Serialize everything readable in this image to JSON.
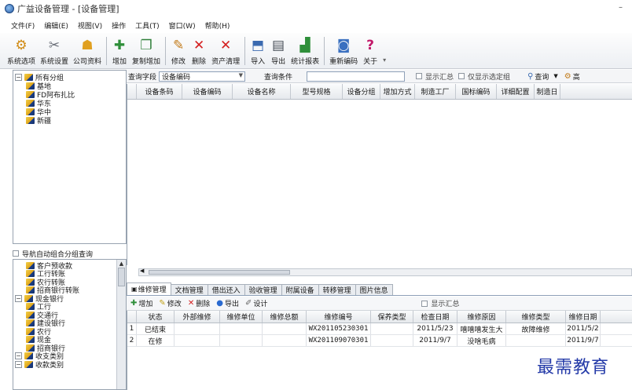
{
  "window": {
    "title": "广益设备管理 - [设备管理]",
    "minimize": "–"
  },
  "menu": [
    "文件(F)",
    "编辑(E)",
    "视图(V)",
    "操作",
    "工具(T)",
    "窗口(W)",
    "帮助(H)"
  ],
  "toolbar": [
    {
      "label": "系统选项",
      "icon": "wrench-icon",
      "glyph": "⚙",
      "color": "#d08a12"
    },
    {
      "label": "系统设置",
      "icon": "tools-icon",
      "glyph": "✂",
      "color": "#6a6f78"
    },
    {
      "label": "公司资料",
      "icon": "company-icon",
      "glyph": "☗",
      "color": "#e0a020"
    },
    {
      "label": "增加",
      "icon": "add-icon",
      "glyph": "✚",
      "color": "#2f8f3a"
    },
    {
      "label": "复制增加",
      "icon": "copy-add-icon",
      "glyph": "❐",
      "color": "#2f7f3a"
    },
    {
      "label": "修改",
      "icon": "edit-icon",
      "glyph": "✎",
      "color": "#c27b1a"
    },
    {
      "label": "删除",
      "icon": "delete-icon",
      "glyph": "✕",
      "color": "#d42020"
    },
    {
      "label": "资产清理",
      "icon": "clear-icon",
      "glyph": "✕",
      "color": "#d42020"
    },
    {
      "label": "导入",
      "icon": "import-icon",
      "glyph": "⬒",
      "color": "#3a6ab0"
    },
    {
      "label": "导出",
      "icon": "export-icon",
      "glyph": "▤",
      "color": "#444b55"
    },
    {
      "label": "统计报表",
      "icon": "report-icon",
      "glyph": "▟",
      "color": "#2f8f3a"
    },
    {
      "label": "重新编码",
      "icon": "recode-icon",
      "glyph": "◙",
      "color": "#3a70c0"
    },
    {
      "label": "关于",
      "icon": "help-icon",
      "glyph": "?",
      "color": "#c21a6a"
    }
  ],
  "tree_top": [
    {
      "label": "所有分组",
      "level": 0
    },
    {
      "label": "基地",
      "level": 1
    },
    {
      "label": "FD阿布扎比",
      "level": 1
    },
    {
      "label": "华东",
      "level": 1
    },
    {
      "label": "华中",
      "level": 1
    },
    {
      "label": "新疆",
      "level": 1
    }
  ],
  "nav_check": "导航自动组合分组查询",
  "tree_bottom": [
    {
      "label": "客户预收款",
      "level": 1
    },
    {
      "label": "工行转账",
      "level": 1
    },
    {
      "label": "农行转账",
      "level": 1
    },
    {
      "label": "招商银行转账",
      "level": 1
    },
    {
      "label": "现金银行",
      "level": 0
    },
    {
      "label": "工行",
      "level": 1
    },
    {
      "label": "交通行",
      "level": 1
    },
    {
      "label": "建设银行",
      "level": 1
    },
    {
      "label": "农行",
      "level": 1
    },
    {
      "label": "现金",
      "level": 1
    },
    {
      "label": "招商银行",
      "level": 1
    },
    {
      "label": "收支类别",
      "level": 0
    },
    {
      "label": "收款类别",
      "level": 0
    }
  ],
  "query": {
    "field_label": "查询字段",
    "field_value": "设备编码",
    "cond_label": "查询条件",
    "show_summary": "显示汇总",
    "only_selected": "仅显示选定组",
    "query_btn": "查询",
    "more_btn": "高"
  },
  "main_columns": [
    "设备条码",
    "设备编码",
    "设备名称",
    "型号规格",
    "设备分组",
    "增加方式",
    "制造工厂",
    "国标编码",
    "详细配置",
    "制造日"
  ],
  "tabs": [
    {
      "label": "维修管理",
      "active": true
    },
    {
      "label": "文档管理",
      "active": false
    },
    {
      "label": "借出还入",
      "active": false
    },
    {
      "label": "验收管理",
      "active": false
    },
    {
      "label": "附属设备",
      "active": false
    },
    {
      "label": "转移管理",
      "active": false
    },
    {
      "label": "图片信息",
      "active": false
    }
  ],
  "sub_toolbar": {
    "add": "增加",
    "edit": "修改",
    "delete": "删除",
    "export": "导出",
    "design": "设计",
    "show_summary": "显示汇总"
  },
  "sub_columns": [
    "",
    "状态",
    "外部维修",
    "维修单位",
    "维修总额",
    "维修编号",
    "保养类型",
    "检查日期",
    "维修原因",
    "维修类型",
    "维修日期"
  ],
  "sub_rows": [
    [
      "1",
      "已结束",
      "",
      "",
      "",
      "WX201105230301",
      "",
      "2011/5/23",
      "嘻嘻嘻发生大",
      "故障维修",
      "2011/5/2"
    ],
    [
      "2",
      "在修",
      "",
      "",
      "",
      "WX201109070301",
      "",
      "2011/9/7",
      "没啥毛病",
      "",
      "2011/9/7"
    ]
  ],
  "watermark": "最需教育"
}
